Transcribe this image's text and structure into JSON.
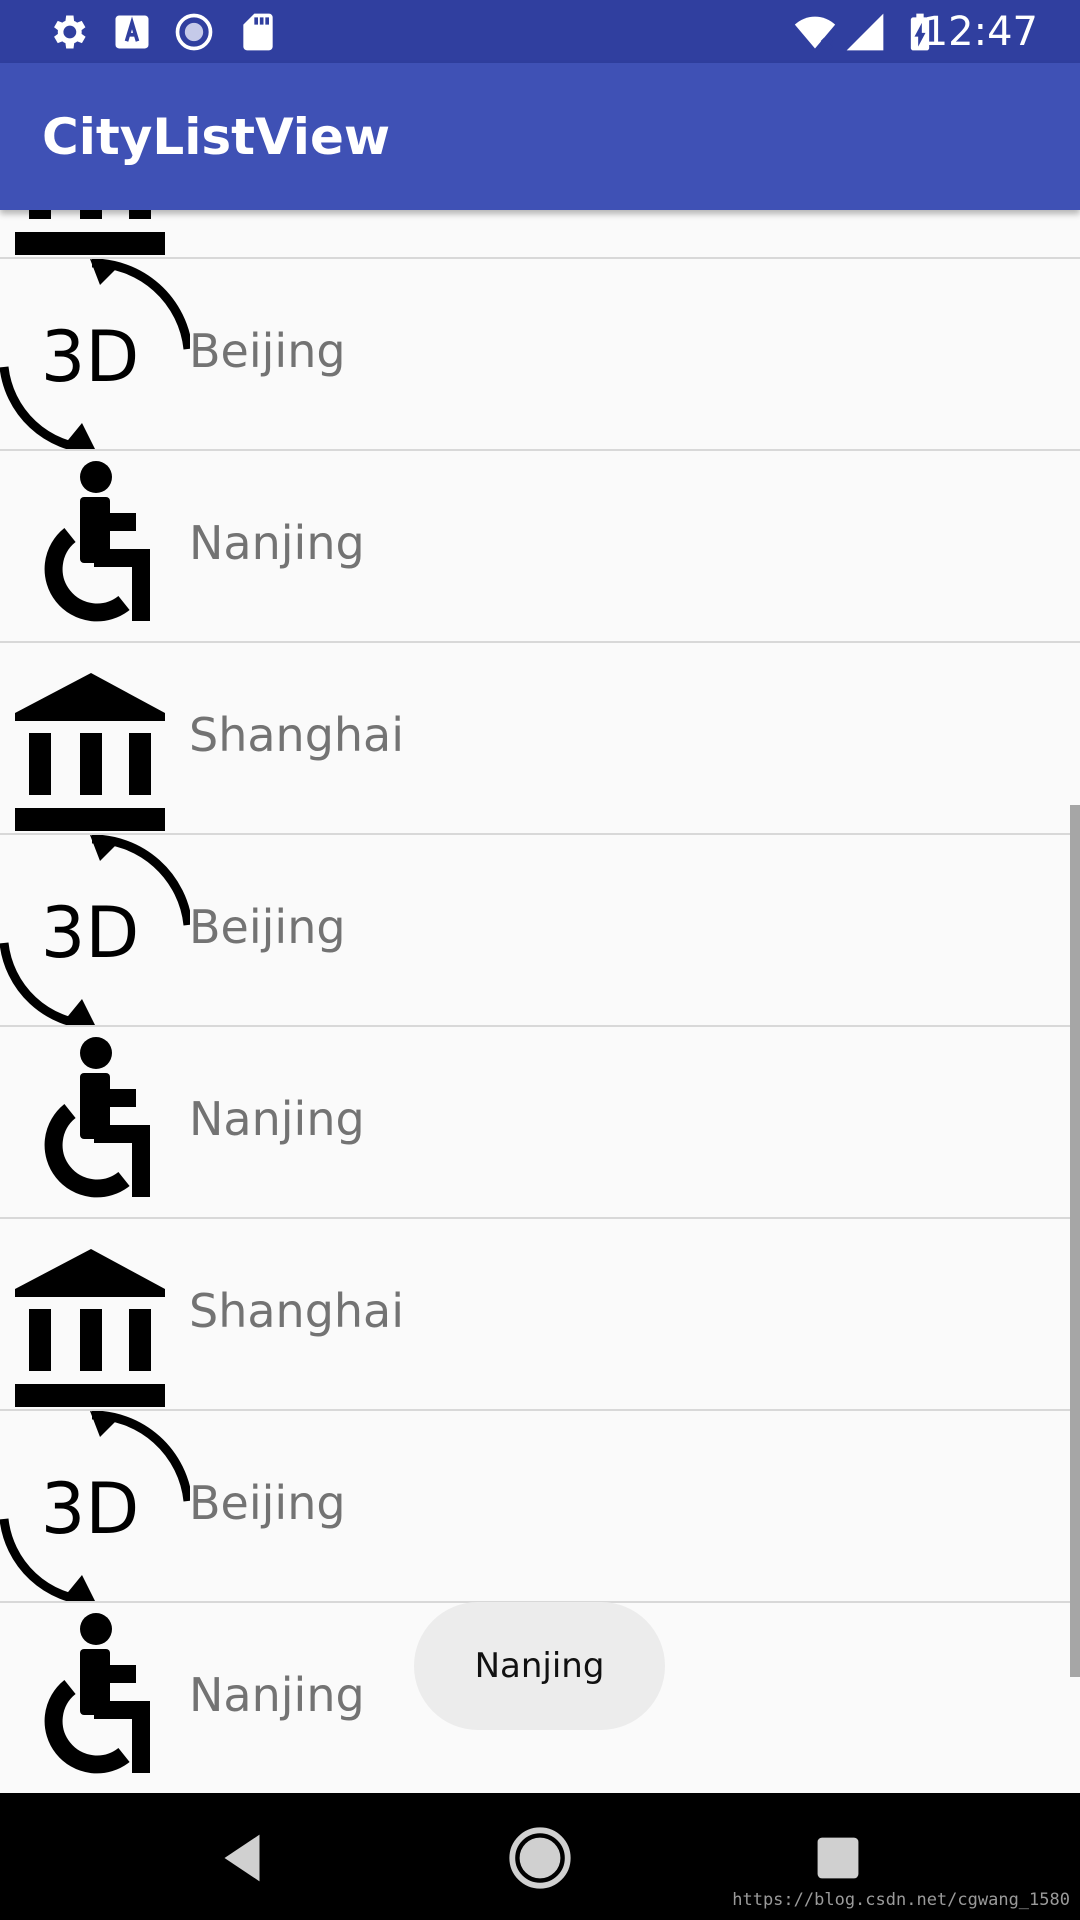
{
  "status_bar": {
    "time": "12:47",
    "left_icons": [
      "settings-icon",
      "text-a-icon",
      "sync-icon",
      "sd-card-icon"
    ],
    "right_icons": [
      "wifi-off-icon",
      "signal-icon",
      "battery-charging-icon"
    ],
    "background": "#303f9f"
  },
  "app_bar": {
    "title": "CityListView",
    "background": "#3f51b5"
  },
  "list": {
    "items": [
      {
        "label": "",
        "icon": "museum-icon"
      },
      {
        "label": "Beijing",
        "icon": "3d-rotation-icon"
      },
      {
        "label": "Nanjing",
        "icon": "accessible-icon"
      },
      {
        "label": "Shanghai",
        "icon": "museum-icon"
      },
      {
        "label": "Beijing",
        "icon": "3d-rotation-icon"
      },
      {
        "label": "Nanjing",
        "icon": "accessible-icon"
      },
      {
        "label": "Shanghai",
        "icon": "museum-icon"
      },
      {
        "label": "Beijing",
        "icon": "3d-rotation-icon"
      },
      {
        "label": "Nanjing",
        "icon": "accessible-icon"
      }
    ]
  },
  "toast": {
    "text": "Nanjing"
  },
  "nav_bar": {
    "buttons": [
      "back-icon",
      "home-icon",
      "recents-icon"
    ]
  },
  "watermark": "https://blog.csdn.net/cgwang_1580"
}
